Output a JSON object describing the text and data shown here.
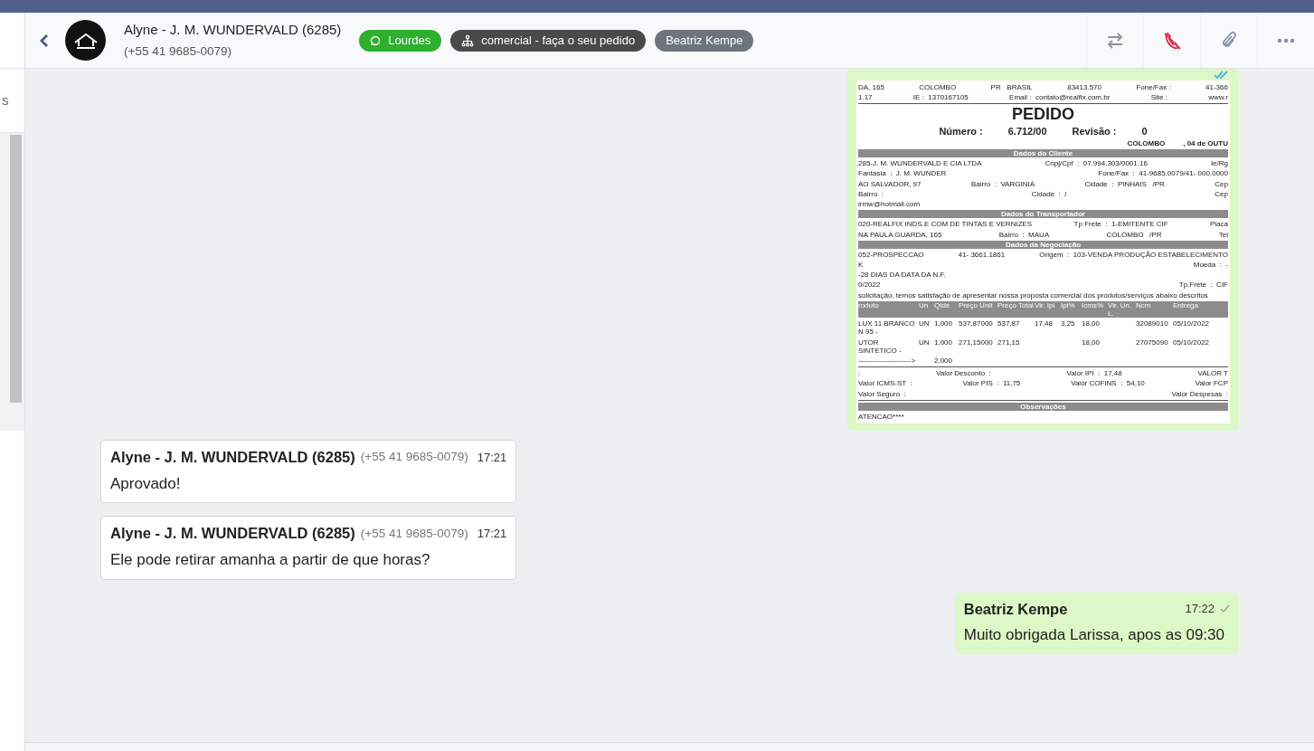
{
  "left_panel": {
    "text": "s"
  },
  "header": {
    "contact_name": "Alyne - J. M. WUNDERVALD (6285)",
    "contact_phone": "(+55 41 9685-0079)",
    "tags": [
      {
        "kind": "whatsapp",
        "label": "Lourdes",
        "color": "#2eaf2e"
      },
      {
        "kind": "department",
        "label": "comercial - faça o seu pedido",
        "color": "#4a4a4a"
      },
      {
        "kind": "user",
        "label": "Beatriz Kempe",
        "color": "#6c757d"
      }
    ],
    "actions": [
      {
        "kind": "transfer",
        "disabled": false
      },
      {
        "kind": "call",
        "disabled": true
      },
      {
        "kind": "attach",
        "disabled": false
      },
      {
        "kind": "more",
        "disabled": false
      }
    ]
  },
  "messages": [
    {
      "kind": "document",
      "outgoing": true,
      "read": true,
      "document": [
        {
          "kind": "line",
          "cells": [
            "DA, 165",
            "COLOMBO",
            "PR   BRASIL",
            "83413.570",
            "Fone/Fax :",
            "41-366"
          ]
        },
        {
          "kind": "line",
          "cells": [
            "1.17",
            "IE :  1370167105",
            "Email :  contato@realfix.com.br",
            "Site :",
            "www.r"
          ]
        },
        {
          "kind": "rule"
        },
        {
          "kind": "title",
          "cells": [
            "PEDIDO"
          ]
        },
        {
          "kind": "subtitle",
          "cells": [
            "Número :",
            "6.712/00",
            "Revisão :",
            "0"
          ]
        },
        {
          "kind": "right",
          "cells": [
            "COLOMBO",
            ", 04 de OUTU"
          ]
        },
        {
          "kind": "section",
          "cells": [
            "Dados do Cliente"
          ]
        },
        {
          "kind": "line",
          "cells": [
            "285-J. M. WUNDERVALD E CIA LTDA",
            "Cnpj/Cpf  :  07.994.303/0001.16",
            "Ie/Rg"
          ]
        },
        {
          "kind": "line",
          "cells": [
            "Fantasia  :  J. M. WUNDER",
            "Fone/Fax  :  41-9685.0079/41- 000.0000"
          ]
        },
        {
          "kind": "line",
          "cells": [
            "AO SALVADOR, 97",
            "Bairro  :  VARGINIA",
            "Cidade  :  PINHAIS   /PR",
            "Cep"
          ]
        },
        {
          "kind": "line",
          "cells": [
            "Bairro  :",
            "Cidade  :  /",
            "Cep"
          ]
        },
        {
          "kind": "line",
          "cells": [
            "irmw@hotmail.com"
          ]
        },
        {
          "kind": "section",
          "cells": [
            "Dados do Transportador"
          ]
        },
        {
          "kind": "line",
          "cells": [
            "020-REALFIX INDS.E COM DE TINTAS E VERNIZES",
            "Tp Frete  :  1-EMITENTE CIF",
            "Placa"
          ]
        },
        {
          "kind": "line",
          "cells": [
            "NA PAULA GUARDA, 165",
            "Bairro  :  MAUA",
            "COLOMBO   /PR",
            "Tel"
          ]
        },
        {
          "kind": "section",
          "cells": [
            "Dados da Negociação"
          ]
        },
        {
          "kind": "line",
          "cells": [
            "052-PROSPECCAO",
            "41- 3661.1861",
            "Origem  :  103-VENDA PRODUÇÃO ESTABELECIMENTO"
          ]
        },
        {
          "kind": "line",
          "cells": [
            "K",
            "Moeda  :  -"
          ]
        },
        {
          "kind": "line",
          "cells": [
            "-28 DIAS DA DATA DA N.F."
          ]
        },
        {
          "kind": "line",
          "cells": [
            "0/2022",
            "Tp.Frete  :  CIF"
          ]
        },
        {
          "kind": "line",
          "cells": [
            "solicitação, temos satisfação de apresentar nossa proposta comercial dos produtos/serviços abaixo descritos"
          ]
        },
        {
          "kind": "table_header",
          "cells": [
            "roduto",
            "Un",
            "Qtde",
            "Preço Unit",
            "Preço Total",
            "Vlr. Ipi",
            "Ipi%",
            "Icms%",
            "Vlr. Un. L.",
            "Ncm",
            "Entrega"
          ]
        },
        {
          "kind": "table_row",
          "cells": [
            "LUX 11 BRANCO N 95 -",
            "UN",
            "1,000",
            "537,87000",
            "537,87",
            "17,48",
            "3,25",
            "18,00",
            null,
            "32089010",
            "05/10/2022"
          ]
        },
        {
          "kind": "table_row",
          "cells": [
            "UTOR SINTETICO -",
            "UN",
            "1,000",
            "271,15000",
            "271,15",
            null,
            null,
            "18,00",
            null,
            "27075090",
            "05/10/2022"
          ]
        },
        {
          "kind": "table_row",
          "cells": [
            "---------------------->",
            null,
            "2,000",
            null,
            null,
            null,
            null,
            null,
            null,
            null,
            null
          ]
        },
        {
          "kind": "rule"
        },
        {
          "kind": "line",
          "cells": [
            ":",
            "Valor Desconto  :",
            "Valor IPI  :  17,48",
            "VALOR T"
          ]
        },
        {
          "kind": "line",
          "cells": [
            "Valor ICMS-ST  :",
            "Valor PIS  :  11,75",
            "Valor COFINS  :  54,10",
            "Valor FCP"
          ]
        },
        {
          "kind": "line",
          "cells": [
            "Valor Seguro  :",
            "Valor Despesas  :"
          ]
        },
        {
          "kind": "rule"
        },
        {
          "kind": "section",
          "cells": [
            "Observações"
          ]
        },
        {
          "kind": "line",
          "cells": [
            "ATENCAO****"
          ]
        }
      ]
    },
    {
      "kind": "text",
      "outgoing": false,
      "sender": "Alyne - J. M. WUNDERVALD (6285)",
      "phone": "(+55 41 9685-0079)",
      "time": "17:21",
      "text": "Aprovado!"
    },
    {
      "kind": "text",
      "outgoing": false,
      "sender": "Alyne - J. M. WUNDERVALD (6285)",
      "phone": "(+55 41 9685-0079)",
      "time": "17:21",
      "text": "Ele pode retirar amanha a partir de que horas?"
    },
    {
      "kind": "text",
      "outgoing": true,
      "read": false,
      "sender": "Beatriz Kempe",
      "time": "17:22",
      "text": "Muito obrigada Larissa, apos as 09:30"
    }
  ]
}
